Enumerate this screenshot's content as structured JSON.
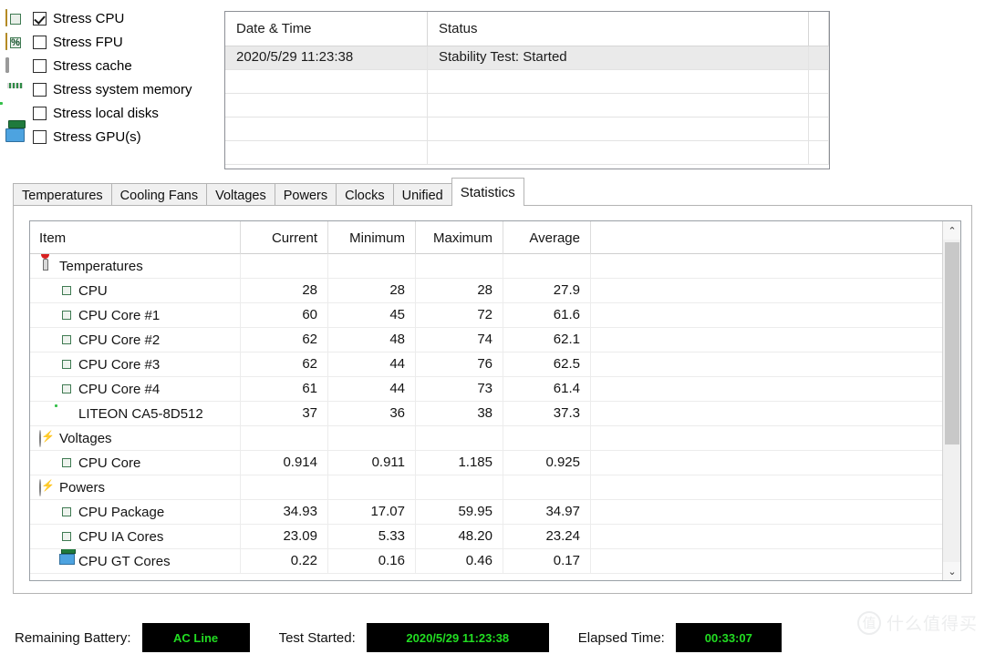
{
  "stress_options": [
    {
      "icon": "cpu-chip-icon",
      "label": "Stress CPU",
      "checked": true
    },
    {
      "icon": "fpu-chip-icon",
      "label": "Stress FPU",
      "checked": false
    },
    {
      "icon": "cache-chip-icon",
      "label": "Stress cache",
      "checked": false
    },
    {
      "icon": "memory-module-icon",
      "label": "Stress system memory",
      "checked": false
    },
    {
      "icon": "hard-disk-icon",
      "label": "Stress local disks",
      "checked": false
    },
    {
      "icon": "gpu-card-icon",
      "label": "Stress GPU(s)",
      "checked": false
    }
  ],
  "log": {
    "columns": [
      "Date & Time",
      "Status",
      ""
    ],
    "rows": [
      {
        "datetime": "2020/5/29 11:23:38",
        "status": "Stability Test: Started",
        "selected": true
      },
      {
        "datetime": "",
        "status": "",
        "selected": false
      },
      {
        "datetime": "",
        "status": "",
        "selected": false
      },
      {
        "datetime": "",
        "status": "",
        "selected": false
      },
      {
        "datetime": "",
        "status": "",
        "selected": false
      }
    ]
  },
  "tabs": [
    {
      "label": "Temperatures",
      "active": false
    },
    {
      "label": "Cooling Fans",
      "active": false
    },
    {
      "label": "Voltages",
      "active": false
    },
    {
      "label": "Powers",
      "active": false
    },
    {
      "label": "Clocks",
      "active": false
    },
    {
      "label": "Unified",
      "active": false
    },
    {
      "label": "Statistics",
      "active": true
    }
  ],
  "statistics": {
    "columns": [
      "Item",
      "Current",
      "Minimum",
      "Maximum",
      "Average"
    ],
    "rows": [
      {
        "type": "category",
        "icon": "thermometer-icon",
        "name": "Temperatures",
        "current": "",
        "minimum": "",
        "maximum": "",
        "average": ""
      },
      {
        "type": "item",
        "icon": "cpu-chip-icon",
        "name": "CPU",
        "current": "28",
        "minimum": "28",
        "maximum": "28",
        "average": "27.9"
      },
      {
        "type": "item",
        "icon": "cpu-chip-icon",
        "name": "CPU Core #1",
        "current": "60",
        "minimum": "45",
        "maximum": "72",
        "average": "61.6"
      },
      {
        "type": "item",
        "icon": "cpu-chip-icon",
        "name": "CPU Core #2",
        "current": "62",
        "minimum": "48",
        "maximum": "74",
        "average": "62.1"
      },
      {
        "type": "item",
        "icon": "cpu-chip-icon",
        "name": "CPU Core #3",
        "current": "62",
        "minimum": "44",
        "maximum": "76",
        "average": "62.5"
      },
      {
        "type": "item",
        "icon": "cpu-chip-icon",
        "name": "CPU Core #4",
        "current": "61",
        "minimum": "44",
        "maximum": "73",
        "average": "61.4"
      },
      {
        "type": "item",
        "icon": "hard-disk-icon",
        "name": "LITEON CA5-8D512",
        "current": "37",
        "minimum": "36",
        "maximum": "38",
        "average": "37.3"
      },
      {
        "type": "category",
        "icon": "lightning-icon",
        "name": "Voltages",
        "current": "",
        "minimum": "",
        "maximum": "",
        "average": ""
      },
      {
        "type": "item",
        "icon": "cpu-chip-icon",
        "name": "CPU Core",
        "current": "0.914",
        "minimum": "0.911",
        "maximum": "1.185",
        "average": "0.925"
      },
      {
        "type": "category",
        "icon": "lightning-icon",
        "name": "Powers",
        "current": "",
        "minimum": "",
        "maximum": "",
        "average": ""
      },
      {
        "type": "item",
        "icon": "cpu-chip-icon",
        "name": "CPU Package",
        "current": "34.93",
        "minimum": "17.07",
        "maximum": "59.95",
        "average": "34.97"
      },
      {
        "type": "item",
        "icon": "cpu-chip-icon",
        "name": "CPU IA Cores",
        "current": "23.09",
        "minimum": "5.33",
        "maximum": "48.20",
        "average": "23.24"
      },
      {
        "type": "item",
        "icon": "gpu-card-icon",
        "name": "CPU GT Cores",
        "current": "0.22",
        "minimum": "0.16",
        "maximum": "0.46",
        "average": "0.17"
      }
    ]
  },
  "scrollbar": {
    "up_arrow": "⌃",
    "down_arrow": "⌄"
  },
  "status_bar": {
    "battery_label": "Remaining Battery:",
    "battery_value": "AC Line",
    "started_label": "Test Started:",
    "started_value": "2020/5/29 11:23:38",
    "elapsed_label": "Elapsed Time:",
    "elapsed_value": "00:33:07",
    "value_color": "#22dd22",
    "value_bg": "#000000"
  },
  "watermark": {
    "mark": "值",
    "text": "什么值得买"
  }
}
